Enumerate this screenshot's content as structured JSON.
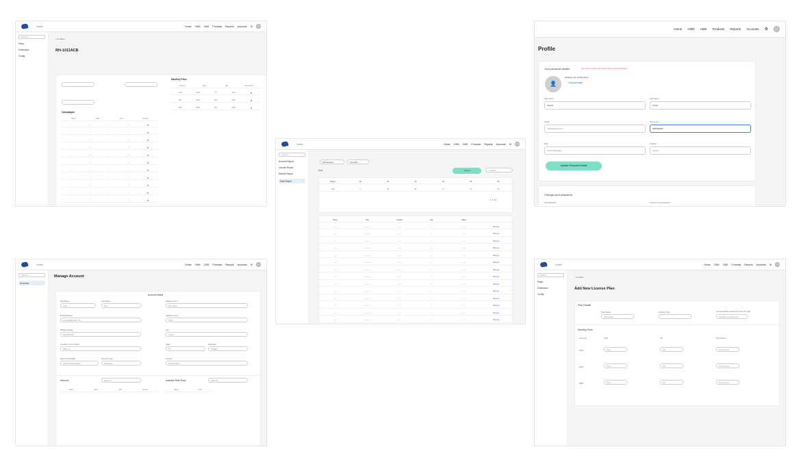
{
  "nav": {
    "home": "Home",
    "cmn": "CMN",
    "cms": "CMS",
    "products": "Products",
    "reports": "Reports",
    "accounts": "Accounts",
    "brand": "Health"
  },
  "search_placeholder": "Search...",
  "sidebar_a": [
    "Plans",
    "Extensions",
    "Config"
  ],
  "sidebar_b": [
    "Account Report",
    "License Report",
    "Module Report",
    "Data Report"
  ],
  "sidebar_c": [
    "Accounts"
  ],
  "panel1": {
    "back": "< Go Back",
    "title": "RH-1011ACB",
    "price_title": "Monthly Price",
    "campaigns": "Campaigns",
    "price_cols": [
      "Currency",
      "Price",
      "Tax",
      "Per Amount"
    ],
    "price_rows": [
      [
        "USD",
        "1000",
        "7%",
        "1070"
      ],
      [
        "INR",
        "1000",
        "10%",
        "1100"
      ],
      [
        "GBP",
        "5000",
        "5%",
        "5250"
      ]
    ],
    "camp_cols": [
      "Name",
      "Start",
      "End",
      "Amount"
    ]
  },
  "profile": {
    "title": "Profile",
    "personal": "Your personal details",
    "warn": "(You cannot change your email, contact your administrator)",
    "change_photo": "Change your profile photo",
    "upload": "Upload image",
    "first_label": "First Name",
    "first": "Shyesh",
    "last_label": "Last Name",
    "last": "Kumar",
    "email_label": "Email",
    "email": "mikedl@gmail.com",
    "phone_label": "Phone No",
    "phone": "5555555555",
    "role_label": "Role",
    "role": "Product Manager",
    "position_label": "Position",
    "position": "position",
    "update_btn": "Update Personal Details",
    "pw_title": "Change your password",
    "old_pw": "Old password",
    "new_pw": "Create a new password"
  },
  "report": {
    "filter": "All Countries",
    "date": "Jan 2021",
    "total": "Total",
    "export": "Export",
    "search": "Search",
    "sum_cols": [
      "Module",
      "N1",
      "N2",
      "N3",
      "N4",
      "N5",
      "N6"
    ],
    "sum_row": [
      "Total",
      "17",
      "98",
      "98",
      "24",
      "22",
      "22"
    ],
    "table_cols": [
      "Name",
      "Title",
      "Location",
      "Age",
      "Salary"
    ],
    "row_action": "Manage",
    "pager": "1-1 of 1"
  },
  "manage": {
    "title": "Manage Account",
    "details": "Account Details",
    "first_label": "First Name",
    "first": "John",
    "last_label": "Last Name",
    "last": "Doe",
    "email_label": "Email Address",
    "email": "example@gmail.com",
    "mobile_label": "Mobile Number",
    "mobile": "0123456789",
    "company_label": "Location or Firm Name",
    "company": "RMC Inc",
    "spec_label": "Account Specialty",
    "spec": "Internal Physiologist",
    "type_label": "Account Type",
    "type": "Enterprise",
    "addr1_label": "Address Line 1",
    "addr1": "123 Street",
    "addr2_label": "Address Line 2",
    "addr2": "Suite",
    "city_label": "City",
    "city": "Austin",
    "state_label": "State",
    "state": "TX",
    "zip_label": "Postcode",
    "zip": "123456",
    "country_label": "Country",
    "country": "United States",
    "discount": "Discount",
    "discount_sel": "Select PI",
    "avail": "Available Rate Plans",
    "avail_sel": "Select P",
    "d_cols": [
      "Name",
      "Start",
      "End",
      "Amount"
    ],
    "a_cols": [
      "Name",
      "Cost"
    ]
  },
  "license": {
    "back": "< Go Back",
    "title": "Add New License Plan",
    "plan_details": "Plan Details",
    "name_label": "Plan Name",
    "name_ph": "Plan Name",
    "type_label": "License Type",
    "cap_label": "Licensed Monthly Assessment Count (Per Unit)",
    "cap_ph": "Number of Assessment",
    "monthly": "Monthly Price",
    "cols": [
      "Currency",
      "Price",
      "Tax",
      "Per Amount"
    ],
    "currencies": [
      "USD",
      "EUR",
      "GBP"
    ],
    "price_ph": "Price",
    "tax_ph": "Tax",
    "per_ph": "Per Amount"
  }
}
